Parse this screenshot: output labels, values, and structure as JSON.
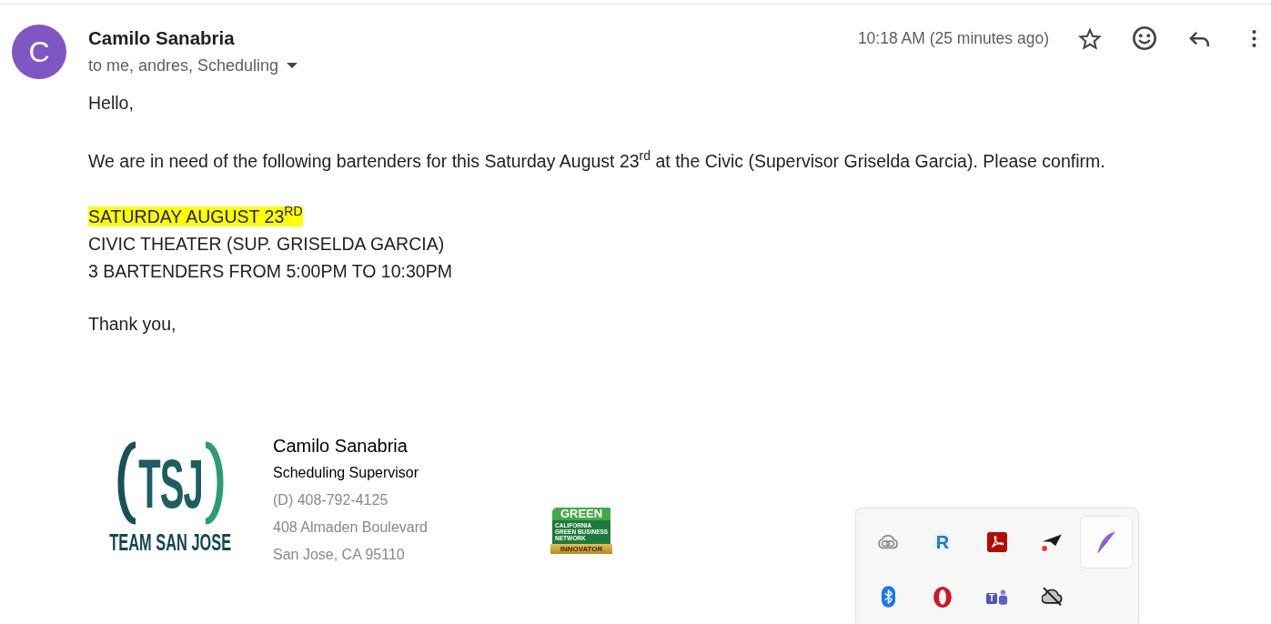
{
  "message": {
    "sender": {
      "initial": "C",
      "name": "Camilo Sanabria"
    },
    "recipients": "to me, andres, Scheduling",
    "time": "10:18 AM (25 minutes ago)",
    "starred": false
  },
  "body": {
    "greeting": "Hello,",
    "request": "We are in need of the following bartenders for this Saturday August 23$^{rd}$ at the Civic (Supervisor Griselda Garcia). Please confirm.",
    "schedule": [
      {
        "text": "SATURDAY AUGUST 23$^{RD}$",
        "highlighted": true
      },
      {
        "text": "CIVIC THEATER (SUP. GRISELDA GARCIA)",
        "highlighted": false
      },
      {
        "text": "3 BARTENDERS FROM 5:00PM TO 10:30PM",
        "highlighted": false
      }
    ],
    "closing": "Thank you,"
  },
  "signature": {
    "logo": {
      "monogram": "TSJ",
      "wordmark": "TEAM SAN JOSE"
    },
    "name": "Camilo Sanabria",
    "title": "Scheduling Supervisor",
    "phone": "(D) 408-792-4125",
    "address": "408 Almaden Boulevard",
    "city": "San Jose, CA 95110",
    "badge": {
      "title": "GREEN",
      "subtitle": "CALIFORNIA GREEN BUSINESS NETWORK",
      "ribbon": "INNOVATOR"
    }
  },
  "tray": {
    "items": [
      {
        "kind": "cloud-rings",
        "hovered": false
      },
      {
        "kind": "letter",
        "label": "R",
        "hovered": false
      },
      {
        "kind": "pdf",
        "hovered": false
      },
      {
        "kind": "paper-plane",
        "hovered": false
      },
      {
        "kind": "feather",
        "hovered": true
      },
      {
        "kind": "bluetooth",
        "hovered": false
      },
      {
        "kind": "opera",
        "hovered": false
      },
      {
        "kind": "teams",
        "label": "T",
        "hovered": false
      },
      {
        "kind": "cloud-off",
        "hovered": false
      }
    ]
  }
}
